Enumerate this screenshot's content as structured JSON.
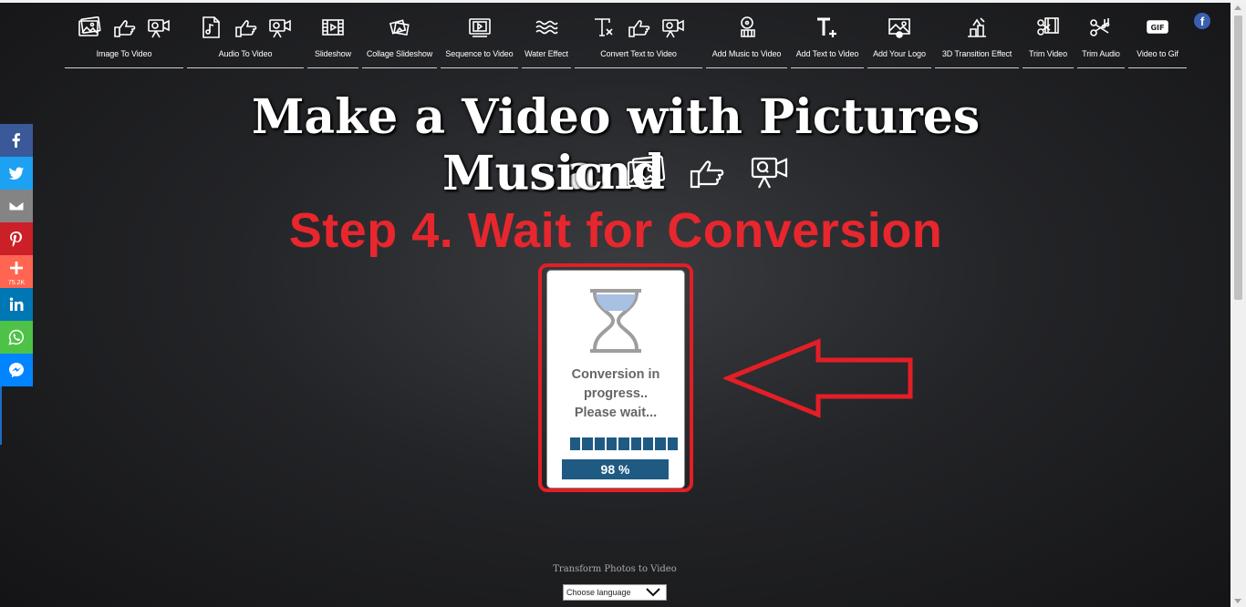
{
  "nav": {
    "items": [
      {
        "label": "Image To Video",
        "icons": [
          "image-icon",
          "pointing-hand-icon",
          "video-camera-icon"
        ]
      },
      {
        "label": "Audio To Video",
        "icons": [
          "audio-file-icon",
          "pointing-hand-icon",
          "video-camera-icon"
        ]
      },
      {
        "label": "Slideshow",
        "icons": [
          "film-strip-icon"
        ]
      },
      {
        "label": "Collage Slideshow",
        "icons": [
          "collage-icon"
        ]
      },
      {
        "label": "Sequence to Video",
        "icons": [
          "sequence-icon"
        ]
      },
      {
        "label": "Water Effect",
        "icons": [
          "water-waves-icon"
        ]
      },
      {
        "label": "Convert Text to Video",
        "icons": [
          "text-icon",
          "pointing-hand-icon",
          "video-camera-icon"
        ]
      },
      {
        "label": "Add Music to Video",
        "icons": [
          "music-film-icon"
        ]
      },
      {
        "label": "Add Text to Video",
        "icons": [
          "text-plus-icon"
        ]
      },
      {
        "label": "Add Your Logo",
        "icons": [
          "logo-image-icon"
        ]
      },
      {
        "label": "3D Transition Effect",
        "icons": [
          "transition-3d-icon"
        ]
      },
      {
        "label": "Trim Video",
        "icons": [
          "trim-video-icon"
        ]
      },
      {
        "label": "Trim Audio",
        "icons": [
          "trim-audio-icon"
        ]
      },
      {
        "label": "Video to Gif",
        "icons": [
          "gif-icon"
        ]
      }
    ],
    "facebook_glyph": "f"
  },
  "social": {
    "buttons": [
      {
        "name": "facebook",
        "color": "#3b5998"
      },
      {
        "name": "twitter",
        "color": "#1da1f2"
      },
      {
        "name": "email",
        "color": "#848484"
      },
      {
        "name": "pinterest",
        "color": "#cb2027"
      },
      {
        "name": "share-more",
        "color": "#ff6550",
        "count": "75.2K"
      },
      {
        "name": "linkedin",
        "color": "#0077b5"
      },
      {
        "name": "whatsapp",
        "color": "#4dc247"
      },
      {
        "name": "messenger",
        "color": "#0084ff"
      }
    ]
  },
  "heading": {
    "line1": "Make a Video with Pictures and",
    "line2": "Music",
    "step": "Step 4. Wait for Conversion"
  },
  "conversion": {
    "status_line1": "Conversion in",
    "status_line2": "progress..",
    "status_line3": "Please wait...",
    "progress_percent": 98,
    "progress_label": "98 %",
    "accent_color": "#1f5a83",
    "highlight_color": "#e41e26"
  },
  "footer": {
    "text": "Transform Photos to Video",
    "language_select": "Choose language"
  }
}
